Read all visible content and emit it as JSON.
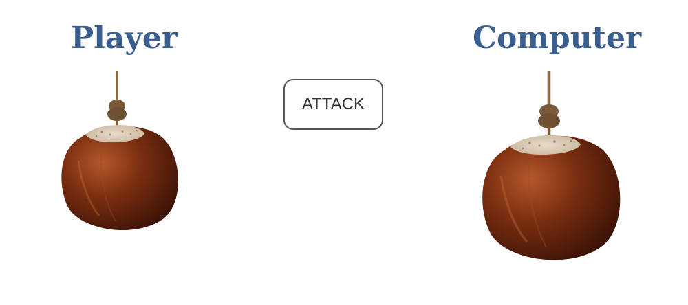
{
  "player": {
    "heading": "Player"
  },
  "computer": {
    "heading": "Computer"
  },
  "controls": {
    "attack_label": "ATTACK"
  },
  "icons": {
    "player_conker": "conker-on-string-icon",
    "computer_conker": "conker-on-string-icon"
  },
  "colors": {
    "heading": "#3a5f8f",
    "button_border": "#555555",
    "conker_shell": "#7a2e10",
    "string": "#8a6a44"
  }
}
